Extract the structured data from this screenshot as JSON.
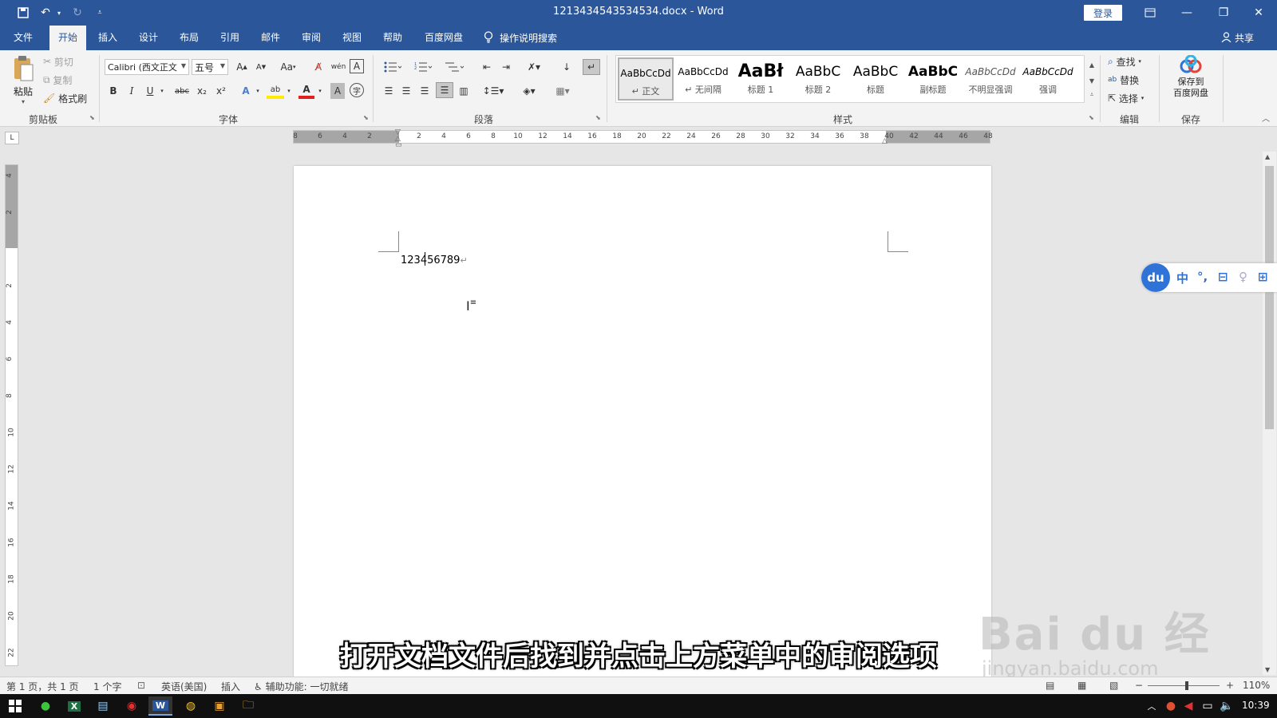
{
  "window": {
    "title": "1213434543534534.docx  -  Word",
    "login_label": "登录"
  },
  "tabs": [
    "文件",
    "开始",
    "插入",
    "设计",
    "布局",
    "引用",
    "邮件",
    "审阅",
    "视图",
    "帮助",
    "百度网盘"
  ],
  "active_tab": "开始",
  "tell_me": "操作说明搜索",
  "share_label": "共享",
  "ribbon": {
    "clipboard": {
      "paste": "粘贴",
      "cut": "剪切",
      "copy": "复制",
      "format_painter": "格式刷",
      "label": "剪贴板"
    },
    "font": {
      "name": "Calibri (西文正文",
      "size": "五号",
      "grow": "A",
      "shrink": "A",
      "case": "Aa",
      "pinyin": "wén",
      "border_char": "A",
      "bold": "B",
      "italic": "I",
      "underline": "U",
      "strike": "abc",
      "sub": "x₂",
      "sup": "x²",
      "text_effect": "A",
      "highlight": "ab",
      "font_color": "A",
      "shading_char": "A",
      "enclose": "字",
      "label": "字体"
    },
    "paragraph": {
      "label": "段落"
    },
    "styles": {
      "label": "样式",
      "items": [
        {
          "preview": "AaBbCcDd",
          "name": "↵ 正文"
        },
        {
          "preview": "AaBbCcDd",
          "name": "↵ 无间隔"
        },
        {
          "preview": "AaBł",
          "name": "标题 1"
        },
        {
          "preview": "AaBbC",
          "name": "标题 2"
        },
        {
          "preview": "AaBbC",
          "name": "标题"
        },
        {
          "preview": "AaBbC",
          "name": "副标题"
        },
        {
          "preview": "AaBbCcDd",
          "name": "不明显强调"
        },
        {
          "preview": "AaBbCcDd",
          "name": "强调"
        }
      ]
    },
    "editing": {
      "find": "查找",
      "replace": "替换",
      "select": "选择",
      "label": "编辑"
    },
    "save": {
      "line1": "保存到",
      "line2": "百度网盘",
      "label": "保存"
    }
  },
  "ruler_h": [
    "8",
    "6",
    "4",
    "2",
    "",
    "2",
    "4",
    "6",
    "8",
    "10",
    "12",
    "14",
    "16",
    "18",
    "20",
    "22",
    "24",
    "26",
    "28",
    "30",
    "32",
    "34",
    "36",
    "38",
    "40",
    "42",
    "44",
    "46",
    "48"
  ],
  "ruler_v": [
    "4",
    "2",
    "",
    "2",
    "4",
    "6",
    "8",
    "10",
    "12",
    "14",
    "16",
    "18",
    "20",
    "22"
  ],
  "ruler_corner": "L",
  "document": {
    "text": "123456789",
    "para_mark": "↵"
  },
  "ime": {
    "logo": "du",
    "items": [
      "中",
      "°,",
      "⊟",
      "♀",
      "⊞"
    ]
  },
  "subtitle": "打开文档文件后找到并点击上方菜单中的审阅选项",
  "watermark": {
    "brand": "Bai  du 经验",
    "url": "jingyan.baidu.com"
  },
  "status": {
    "page": "第 1 页，共 1 页",
    "words": "1 个字",
    "language": "英语(美国)",
    "mode": "插入",
    "accessibility": "辅助功能: 一切就绪",
    "zoom": "110%"
  },
  "clock": "10:39"
}
